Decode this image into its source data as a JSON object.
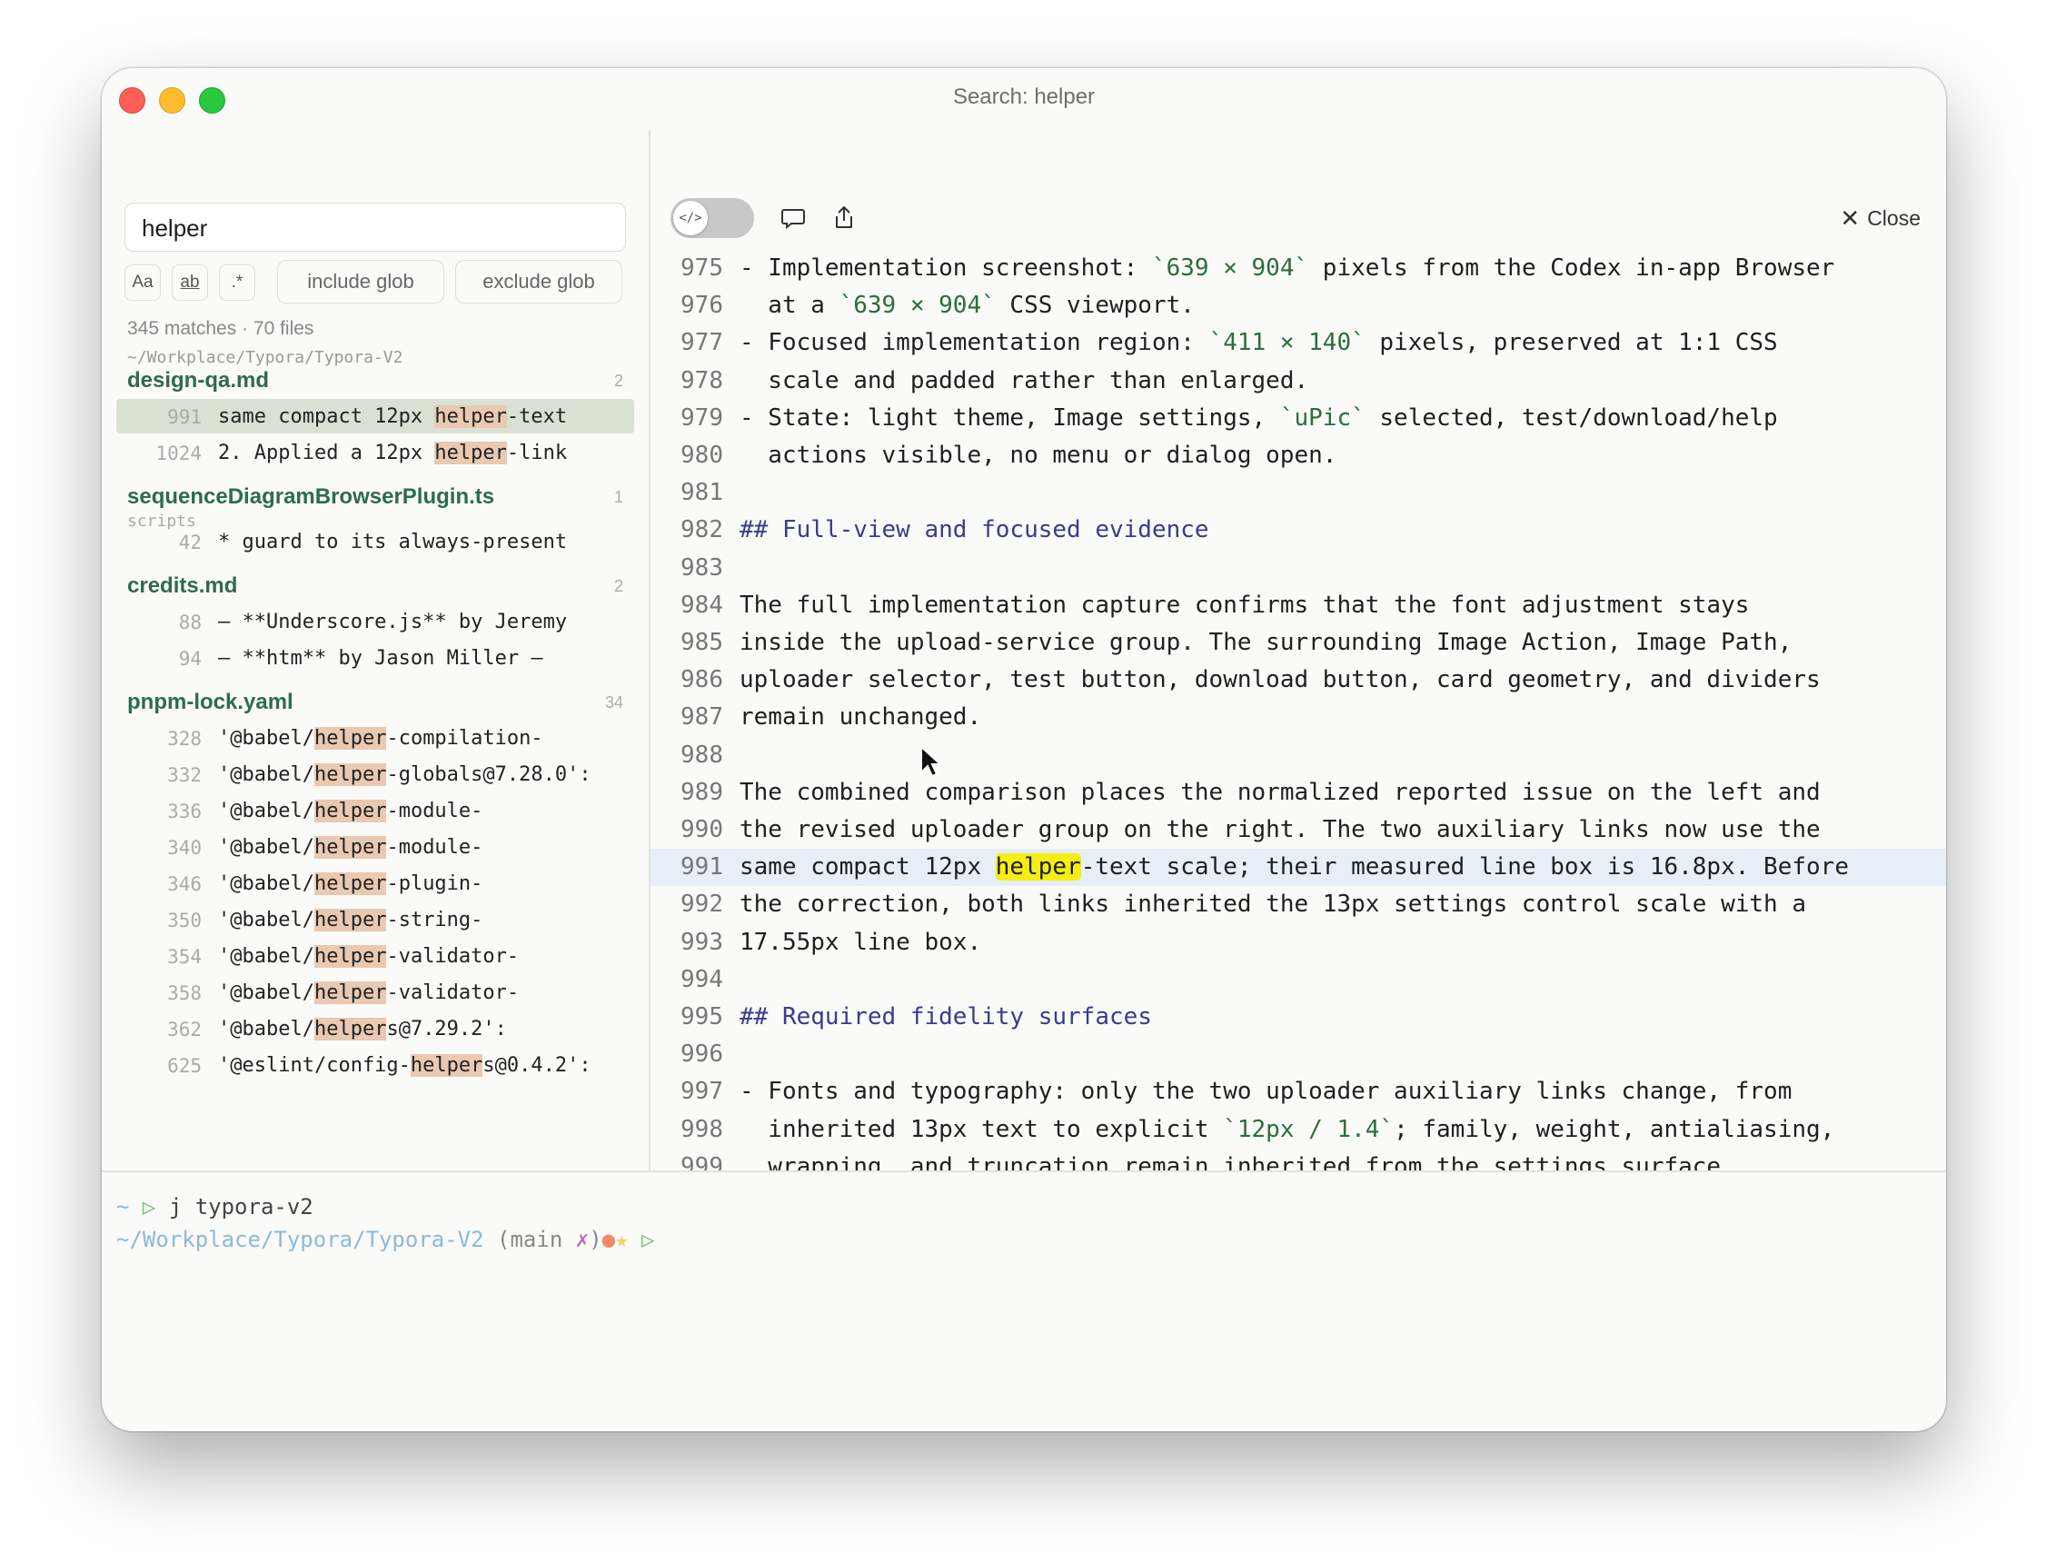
{
  "window": {
    "title": "Search: helper"
  },
  "search": {
    "query": "helper",
    "options": [
      "Aa",
      "ab",
      ".*"
    ],
    "include_glob_placeholder": "include glob",
    "exclude_glob_placeholder": "exclude glob",
    "summary": "345 matches · 70 files",
    "path": "~/Workplace/Typora/Typora-V2"
  },
  "results": [
    {
      "file": "design-qa.md",
      "count": "2",
      "subtitle": "",
      "matches": [
        {
          "line": "991",
          "pre": "same compact 12px ",
          "hit": "helper",
          "post": "-text",
          "selected": true
        },
        {
          "line": "1024",
          "pre": "2. Applied a 12px ",
          "hit": "helper",
          "post": "-link"
        }
      ]
    },
    {
      "file": "sequenceDiagramBrowserPlugin.ts",
      "count": "1",
      "subtitle": "scripts",
      "matches": [
        {
          "line": "42",
          "pre": "* guard to its always-present",
          "hit": "",
          "post": ""
        }
      ]
    },
    {
      "file": "credits.md",
      "count": "2",
      "subtitle": "",
      "matches": [
        {
          "line": "88",
          "pre": "– **Underscore.js** by Jeremy",
          "hit": "",
          "post": ""
        },
        {
          "line": "94",
          "pre": "– **htm** by Jason Miller –",
          "hit": "",
          "post": ""
        }
      ]
    },
    {
      "file": "pnpm-lock.yaml",
      "count": "34",
      "subtitle": "",
      "matches": [
        {
          "line": "328",
          "pre": "'@babel/",
          "hit": "helper",
          "post": "-compilation-"
        },
        {
          "line": "332",
          "pre": "'@babel/",
          "hit": "helper",
          "post": "-globals@7.28.0':"
        },
        {
          "line": "336",
          "pre": "'@babel/",
          "hit": "helper",
          "post": "-module-"
        },
        {
          "line": "340",
          "pre": "'@babel/",
          "hit": "helper",
          "post": "-module-"
        },
        {
          "line": "346",
          "pre": "'@babel/",
          "hit": "helper",
          "post": "-plugin-"
        },
        {
          "line": "350",
          "pre": "'@babel/",
          "hit": "helper",
          "post": "-string-"
        },
        {
          "line": "354",
          "pre": "'@babel/",
          "hit": "helper",
          "post": "-validator-"
        },
        {
          "line": "358",
          "pre": "'@babel/",
          "hit": "helper",
          "post": "-validator-"
        },
        {
          "line": "362",
          "pre": "'@babel/",
          "hit": "helper",
          "post": "s@7.29.2':"
        },
        {
          "line": "625",
          "pre": "'@eslint/config-",
          "hit": "helper",
          "post": "s@0.4.2':"
        }
      ]
    }
  ],
  "editor": {
    "close_label": "Close",
    "lines": [
      {
        "n": "975",
        "parts": [
          [
            "t",
            "- Implementation screenshot: "
          ],
          [
            "c",
            "`639 × 904`"
          ],
          [
            "t",
            " pixels from the Codex in-app Browser"
          ]
        ]
      },
      {
        "n": "976",
        "parts": [
          [
            "t",
            "  at a "
          ],
          [
            "c",
            "`639 × 904`"
          ],
          [
            "t",
            " CSS viewport."
          ]
        ]
      },
      {
        "n": "977",
        "parts": [
          [
            "t",
            "- Focused implementation region: "
          ],
          [
            "c",
            "`411 × 140`"
          ],
          [
            "t",
            " pixels, preserved at 1:1 CSS"
          ]
        ]
      },
      {
        "n": "978",
        "parts": [
          [
            "t",
            "  scale and padded rather than enlarged."
          ]
        ]
      },
      {
        "n": "979",
        "parts": [
          [
            "t",
            "- State: light theme, Image settings, "
          ],
          [
            "c",
            "`uPic`"
          ],
          [
            "t",
            " selected, test/download/help"
          ]
        ]
      },
      {
        "n": "980",
        "parts": [
          [
            "t",
            "  actions visible, no menu or dialog open."
          ]
        ]
      },
      {
        "n": "981",
        "parts": []
      },
      {
        "n": "982",
        "parts": [
          [
            "h",
            "## Full-view and focused evidence"
          ]
        ]
      },
      {
        "n": "983",
        "parts": []
      },
      {
        "n": "984",
        "parts": [
          [
            "t",
            "The full implementation capture confirms that the font adjustment stays"
          ]
        ]
      },
      {
        "n": "985",
        "parts": [
          [
            "t",
            "inside the upload-service group. The surrounding Image Action, Image Path,"
          ]
        ]
      },
      {
        "n": "986",
        "parts": [
          [
            "t",
            "uploader selector, test button, download button, card geometry, and dividers"
          ]
        ]
      },
      {
        "n": "987",
        "parts": [
          [
            "t",
            "remain unchanged."
          ]
        ]
      },
      {
        "n": "988",
        "parts": []
      },
      {
        "n": "989",
        "parts": [
          [
            "t",
            "The combined comparison places the normalized reported issue on the left and"
          ]
        ]
      },
      {
        "n": "990",
        "parts": [
          [
            "t",
            "the revised uploader group on the right. The two auxiliary links now use the"
          ]
        ]
      },
      {
        "n": "991",
        "current": true,
        "parts": [
          [
            "t",
            "same compact 12px "
          ],
          [
            "m",
            "helper"
          ],
          [
            "t",
            "-text scale; their measured line box is 16.8px. Before"
          ]
        ]
      },
      {
        "n": "992",
        "parts": [
          [
            "t",
            "the correction, both links inherited the 13px settings control scale with a"
          ]
        ]
      },
      {
        "n": "993",
        "parts": [
          [
            "t",
            "17.55px line box."
          ]
        ]
      },
      {
        "n": "994",
        "parts": []
      },
      {
        "n": "995",
        "parts": [
          [
            "h",
            "## Required fidelity surfaces"
          ]
        ]
      },
      {
        "n": "996",
        "parts": []
      },
      {
        "n": "997",
        "parts": [
          [
            "t",
            "- Fonts and typography: only the two uploader auxiliary links change, from"
          ]
        ]
      },
      {
        "n": "998",
        "parts": [
          [
            "t",
            "  inherited 13px text to explicit "
          ],
          [
            "c",
            "`12px / 1.4`"
          ],
          [
            "t",
            "; family, weight, antialiasing,"
          ]
        ]
      },
      {
        "n": "999",
        "parts": [
          [
            "t",
            "  wrapping, and truncation remain inherited from the settings surface."
          ]
        ]
      }
    ]
  },
  "terminal": {
    "line1": {
      "tilde": "~",
      "prompt": "▷",
      "cmd": "j typora-v2"
    },
    "line2": {
      "path": "~/Workplace/Typora/Typora-V2",
      "branch_open": "(main ",
      "dirty": "✗",
      "branch_close": ")",
      "dot1": "●",
      "dot2": "★",
      "prompt": "▷"
    }
  },
  "colors": {
    "match_highlight": "#e9c9b2",
    "current_match": "#f6ee12",
    "file_name": "#2f6b4f",
    "current_line": "#e6eef8"
  }
}
